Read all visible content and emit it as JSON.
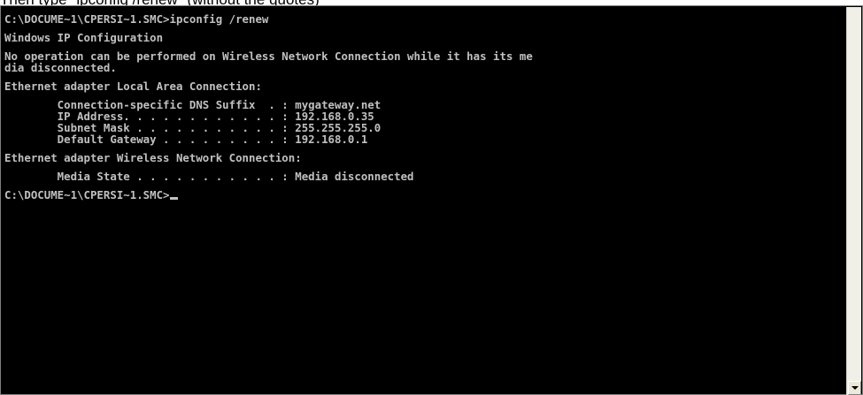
{
  "caption": "Then type \"ipconfig /renew\" (without the quotes)",
  "console": {
    "lines": [
      "C:\\DOCUME~1\\CPERSI~1.SMC>ipconfig /renew",
      "",
      "Windows IP Configuration",
      "",
      "No operation can be performed on Wireless Network Connection while it has its me",
      "dia disconnected.",
      "",
      "Ethernet adapter Local Area Connection:",
      "",
      "        Connection-specific DNS Suffix  . : mygateway.net",
      "        IP Address. . . . . . . . . . . . : 192.168.0.35",
      "        Subnet Mask . . . . . . . . . . . : 255.255.255.0",
      "        Default Gateway . . . . . . . . . : 192.168.0.1",
      "",
      "Ethernet adapter Wireless Network Connection:",
      "",
      "        Media State . . . . . . . . . . . : Media disconnected",
      "",
      "C:\\DOCUME~1\\CPERSI~1.SMC>"
    ]
  },
  "colors": {
    "console_background": "#000000",
    "console_text": "#c0c0c0"
  },
  "icons": {
    "scroll_down": "triangle-down-icon"
  }
}
